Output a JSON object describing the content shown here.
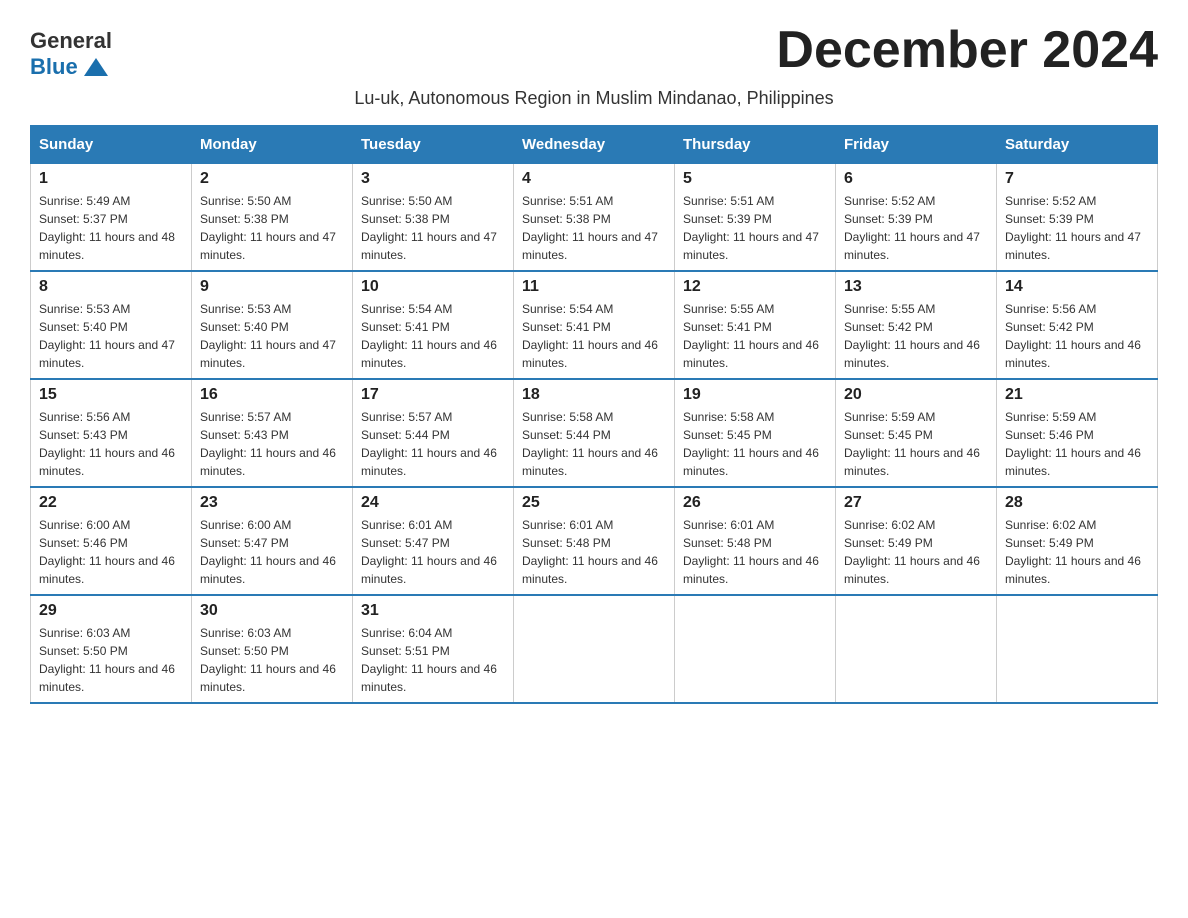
{
  "logo": {
    "general": "General",
    "blue": "Blue"
  },
  "title": "December 2024",
  "subtitle": "Lu-uk, Autonomous Region in Muslim Mindanao, Philippines",
  "days_of_week": [
    "Sunday",
    "Monday",
    "Tuesday",
    "Wednesday",
    "Thursday",
    "Friday",
    "Saturday"
  ],
  "weeks": [
    [
      {
        "day": "1",
        "sunrise": "5:49 AM",
        "sunset": "5:37 PM",
        "daylight": "11 hours and 48 minutes."
      },
      {
        "day": "2",
        "sunrise": "5:50 AM",
        "sunset": "5:38 PM",
        "daylight": "11 hours and 47 minutes."
      },
      {
        "day": "3",
        "sunrise": "5:50 AM",
        "sunset": "5:38 PM",
        "daylight": "11 hours and 47 minutes."
      },
      {
        "day": "4",
        "sunrise": "5:51 AM",
        "sunset": "5:38 PM",
        "daylight": "11 hours and 47 minutes."
      },
      {
        "day": "5",
        "sunrise": "5:51 AM",
        "sunset": "5:39 PM",
        "daylight": "11 hours and 47 minutes."
      },
      {
        "day": "6",
        "sunrise": "5:52 AM",
        "sunset": "5:39 PM",
        "daylight": "11 hours and 47 minutes."
      },
      {
        "day": "7",
        "sunrise": "5:52 AM",
        "sunset": "5:39 PM",
        "daylight": "11 hours and 47 minutes."
      }
    ],
    [
      {
        "day": "8",
        "sunrise": "5:53 AM",
        "sunset": "5:40 PM",
        "daylight": "11 hours and 47 minutes."
      },
      {
        "day": "9",
        "sunrise": "5:53 AM",
        "sunset": "5:40 PM",
        "daylight": "11 hours and 47 minutes."
      },
      {
        "day": "10",
        "sunrise": "5:54 AM",
        "sunset": "5:41 PM",
        "daylight": "11 hours and 46 minutes."
      },
      {
        "day": "11",
        "sunrise": "5:54 AM",
        "sunset": "5:41 PM",
        "daylight": "11 hours and 46 minutes."
      },
      {
        "day": "12",
        "sunrise": "5:55 AM",
        "sunset": "5:41 PM",
        "daylight": "11 hours and 46 minutes."
      },
      {
        "day": "13",
        "sunrise": "5:55 AM",
        "sunset": "5:42 PM",
        "daylight": "11 hours and 46 minutes."
      },
      {
        "day": "14",
        "sunrise": "5:56 AM",
        "sunset": "5:42 PM",
        "daylight": "11 hours and 46 minutes."
      }
    ],
    [
      {
        "day": "15",
        "sunrise": "5:56 AM",
        "sunset": "5:43 PM",
        "daylight": "11 hours and 46 minutes."
      },
      {
        "day": "16",
        "sunrise": "5:57 AM",
        "sunset": "5:43 PM",
        "daylight": "11 hours and 46 minutes."
      },
      {
        "day": "17",
        "sunrise": "5:57 AM",
        "sunset": "5:44 PM",
        "daylight": "11 hours and 46 minutes."
      },
      {
        "day": "18",
        "sunrise": "5:58 AM",
        "sunset": "5:44 PM",
        "daylight": "11 hours and 46 minutes."
      },
      {
        "day": "19",
        "sunrise": "5:58 AM",
        "sunset": "5:45 PM",
        "daylight": "11 hours and 46 minutes."
      },
      {
        "day": "20",
        "sunrise": "5:59 AM",
        "sunset": "5:45 PM",
        "daylight": "11 hours and 46 minutes."
      },
      {
        "day": "21",
        "sunrise": "5:59 AM",
        "sunset": "5:46 PM",
        "daylight": "11 hours and 46 minutes."
      }
    ],
    [
      {
        "day": "22",
        "sunrise": "6:00 AM",
        "sunset": "5:46 PM",
        "daylight": "11 hours and 46 minutes."
      },
      {
        "day": "23",
        "sunrise": "6:00 AM",
        "sunset": "5:47 PM",
        "daylight": "11 hours and 46 minutes."
      },
      {
        "day": "24",
        "sunrise": "6:01 AM",
        "sunset": "5:47 PM",
        "daylight": "11 hours and 46 minutes."
      },
      {
        "day": "25",
        "sunrise": "6:01 AM",
        "sunset": "5:48 PM",
        "daylight": "11 hours and 46 minutes."
      },
      {
        "day": "26",
        "sunrise": "6:01 AM",
        "sunset": "5:48 PM",
        "daylight": "11 hours and 46 minutes."
      },
      {
        "day": "27",
        "sunrise": "6:02 AM",
        "sunset": "5:49 PM",
        "daylight": "11 hours and 46 minutes."
      },
      {
        "day": "28",
        "sunrise": "6:02 AM",
        "sunset": "5:49 PM",
        "daylight": "11 hours and 46 minutes."
      }
    ],
    [
      {
        "day": "29",
        "sunrise": "6:03 AM",
        "sunset": "5:50 PM",
        "daylight": "11 hours and 46 minutes."
      },
      {
        "day": "30",
        "sunrise": "6:03 AM",
        "sunset": "5:50 PM",
        "daylight": "11 hours and 46 minutes."
      },
      {
        "day": "31",
        "sunrise": "6:04 AM",
        "sunset": "5:51 PM",
        "daylight": "11 hours and 46 minutes."
      },
      null,
      null,
      null,
      null
    ]
  ]
}
